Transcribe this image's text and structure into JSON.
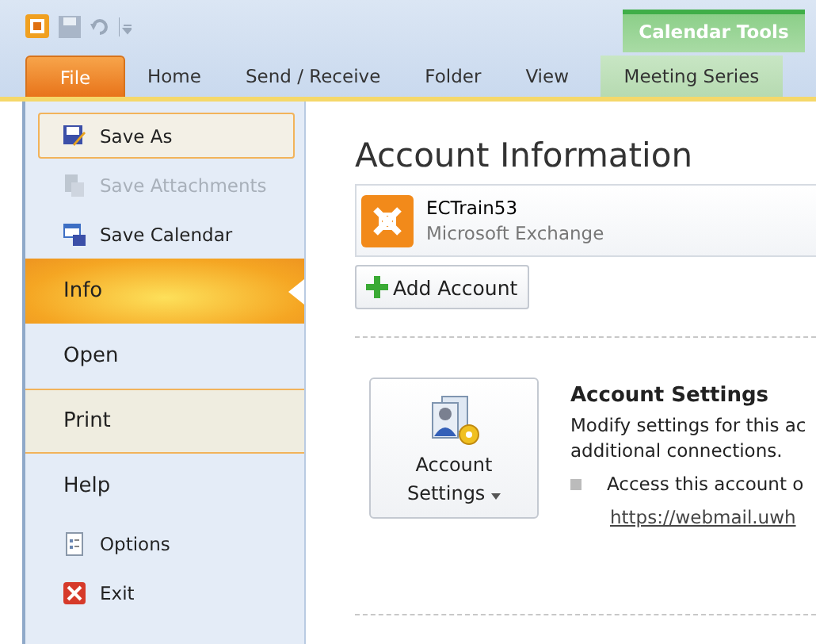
{
  "ribbon": {
    "contextual_group": {
      "label": "Calendar Tools"
    },
    "tabs": [
      {
        "label": "File",
        "selected": true,
        "contextual": false
      },
      {
        "label": "Home",
        "selected": false,
        "contextual": false
      },
      {
        "label": "Send / Receive",
        "selected": false,
        "contextual": false
      },
      {
        "label": "Folder",
        "selected": false,
        "contextual": false
      },
      {
        "label": "View",
        "selected": false,
        "contextual": false
      },
      {
        "label": "Meeting Series",
        "selected": false,
        "contextual": true
      }
    ]
  },
  "sidebar": {
    "items": [
      {
        "kind": "command",
        "label": "Save As",
        "selected": false,
        "highlighted": true,
        "disabled": false
      },
      {
        "kind": "command",
        "label": "Save Attachments",
        "selected": false,
        "highlighted": false,
        "disabled": true
      },
      {
        "kind": "command",
        "label": "Save Calendar",
        "selected": false,
        "highlighted": false,
        "disabled": false
      },
      {
        "kind": "tab",
        "label": "Info",
        "selected": true,
        "highlighted": false,
        "disabled": false
      },
      {
        "kind": "tab",
        "label": "Open",
        "selected": false,
        "highlighted": false,
        "disabled": false
      },
      {
        "kind": "tab",
        "label": "Print",
        "selected": false,
        "highlighted": true,
        "disabled": false
      },
      {
        "kind": "tab",
        "label": "Help",
        "selected": false,
        "highlighted": false,
        "disabled": false
      },
      {
        "kind": "command",
        "label": "Options",
        "selected": false,
        "highlighted": false,
        "disabled": false
      },
      {
        "kind": "command",
        "label": "Exit",
        "selected": false,
        "highlighted": false,
        "disabled": false
      }
    ]
  },
  "main": {
    "title": "Account Information",
    "account": {
      "name": "ECTrain53",
      "type": "Microsoft Exchange"
    },
    "add_account_button": "Add Account",
    "account_settings": {
      "button_line_1": "Account",
      "button_line_2": "Settings",
      "heading": "Account Settings",
      "description_1": "Modify settings for this ac",
      "description_2": "additional connections.",
      "bullet": "Access this account o",
      "link": "https://webmail.uwh"
    }
  }
}
